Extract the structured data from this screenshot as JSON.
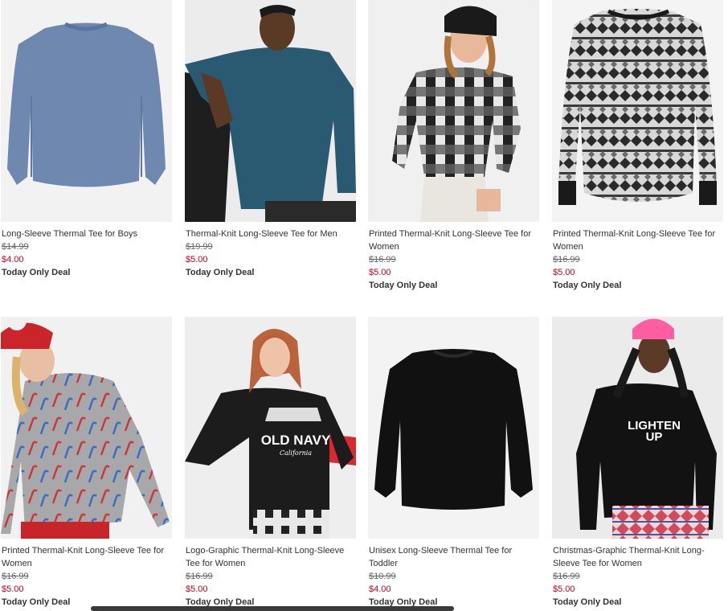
{
  "products": [
    {
      "name": "Long-Sleeve Thermal Tee for Boys",
      "old_price": "$14.99",
      "price": "$4.00",
      "deal": "Today Only Deal",
      "image": "blue-thermal-shirt-photo"
    },
    {
      "name": "Thermal-Knit Long-Sleeve Tee for Men",
      "old_price": "$19.99",
      "price": "$5.00",
      "deal": "Today Only Deal",
      "image": "man-teal-thermal-photo"
    },
    {
      "name": "Printed Thermal-Knit Long-Sleeve Tee for Women",
      "old_price": "$16.99",
      "price": "$5.00",
      "deal": "Today Only Deal",
      "image": "woman-buffalo-check-photo"
    },
    {
      "name": "Printed Thermal-Knit Long-Sleeve Tee for Women",
      "old_price": "$16.99",
      "price": "$5.00",
      "deal": "Today Only Deal",
      "image": "fair-isle-shirt-photo"
    },
    {
      "name": "Printed Thermal-Knit Long-Sleeve Tee for Women",
      "old_price": "$16.99",
      "price": "$5.00",
      "deal": "Today Only Deal",
      "image": "woman-candy-cane-photo"
    },
    {
      "name": "Logo-Graphic Thermal-Knit Long-Sleeve Tee for Women",
      "old_price": "$16.99",
      "price": "$5.00",
      "deal": "Today Only Deal",
      "image": "woman-old-navy-logo-photo",
      "logo_text": "OLD NAVY",
      "logo_sub": "California"
    },
    {
      "name": "Unisex Long-Sleeve Thermal Tee for Toddler",
      "old_price": "$10.99",
      "price": "$4.00",
      "deal": "Today Only Deal",
      "image": "black-toddler-shirt-photo"
    },
    {
      "name": "Christmas-Graphic Thermal-Knit Long-Sleeve Tee for Women",
      "old_price": "$16.99",
      "price": "$5.00",
      "deal": "Today Only Deal",
      "image": "woman-lighten-up-photo",
      "graphic_text_1": "LIGHTEN",
      "graphic_text_2": "UP"
    }
  ]
}
